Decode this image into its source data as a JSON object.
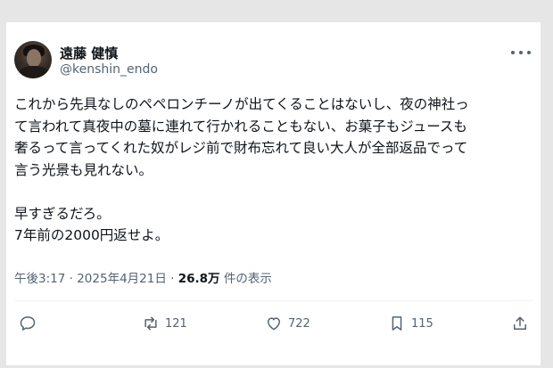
{
  "author": {
    "display_name": "遠藤 健慎",
    "handle": "@kenshin_endo"
  },
  "post": {
    "lines": [
      "これから先具なしのペペロンチーノが出てくることはないし、夜の神社っ",
      "て言われて真夜中の墓に連れて行かれることもない、お菓子もジュースも",
      "奢るって言ってくれた奴がレジ前で財布忘れて良い大人が全部返品でって",
      "言う光景も見れない。",
      "",
      "早すぎるだろ。",
      "7年前の2000円返せよ。"
    ],
    "time": "午後3:17",
    "separator": "·",
    "date": "2025年4月21日",
    "views_count": "26.8万",
    "views_label": "件の表示"
  },
  "actions": {
    "reply_count": "",
    "repost_count": "121",
    "like_count": "722",
    "bookmark_count": "115"
  },
  "icons": [
    "avatar",
    "more-icon",
    "reply-icon",
    "repost-icon",
    "like-icon",
    "bookmark-icon",
    "share-icon"
  ]
}
